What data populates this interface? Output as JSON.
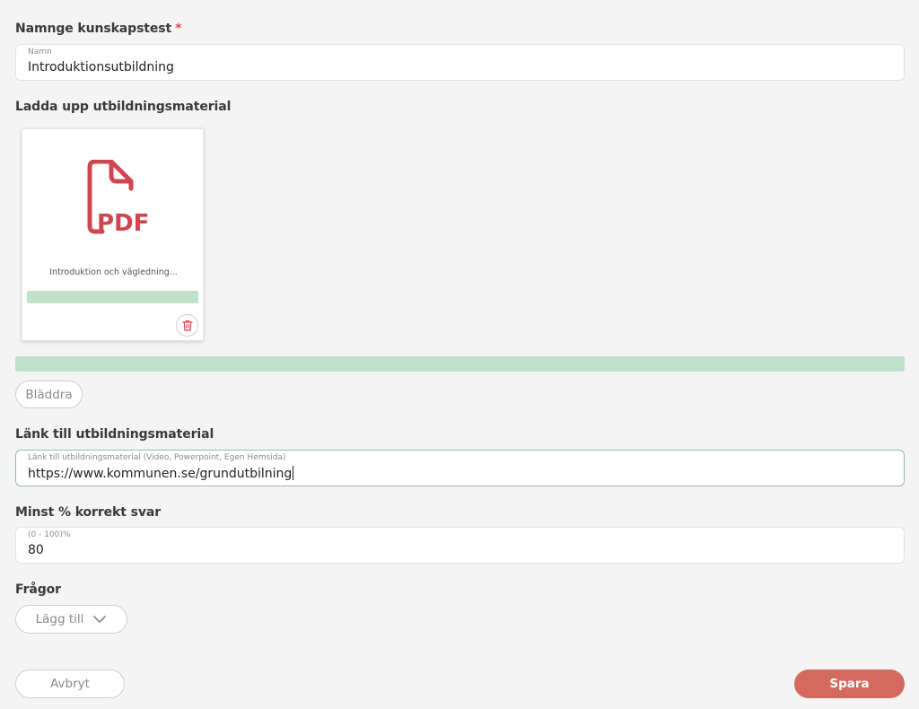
{
  "name_section": {
    "label": "Namnge kunskapstest",
    "required_mark": "*",
    "caption": "Namn",
    "value": "Introduktionsutbildning"
  },
  "upload_section": {
    "label": "Ladda upp utbildningsmaterial",
    "file": {
      "icon": "pdf-file-icon",
      "name": "Introduktion och vägledning...",
      "progress_percent": 100
    },
    "overall_progress_percent": 100,
    "browse_label": "Bläddra"
  },
  "link_section": {
    "label": "Länk till utbildningsmaterial",
    "caption": "Länk till utbildningsmaterial (Video, Powerpoint, Egen Hemsida)",
    "value": "https://www.kommunen.se/grundutbilning"
  },
  "score_section": {
    "label": "Minst % korrekt svar",
    "caption": "(0 - 100)%",
    "value": "80"
  },
  "questions_section": {
    "label": "Frågor",
    "add_label": "Lägg till"
  },
  "footer": {
    "cancel_label": "Avbryt",
    "save_label": "Spara"
  },
  "colors": {
    "accent": "#d46a5e",
    "progress": "#bfe0c9",
    "pdf_icon": "#d0454f",
    "background": "#f4f4f4"
  }
}
